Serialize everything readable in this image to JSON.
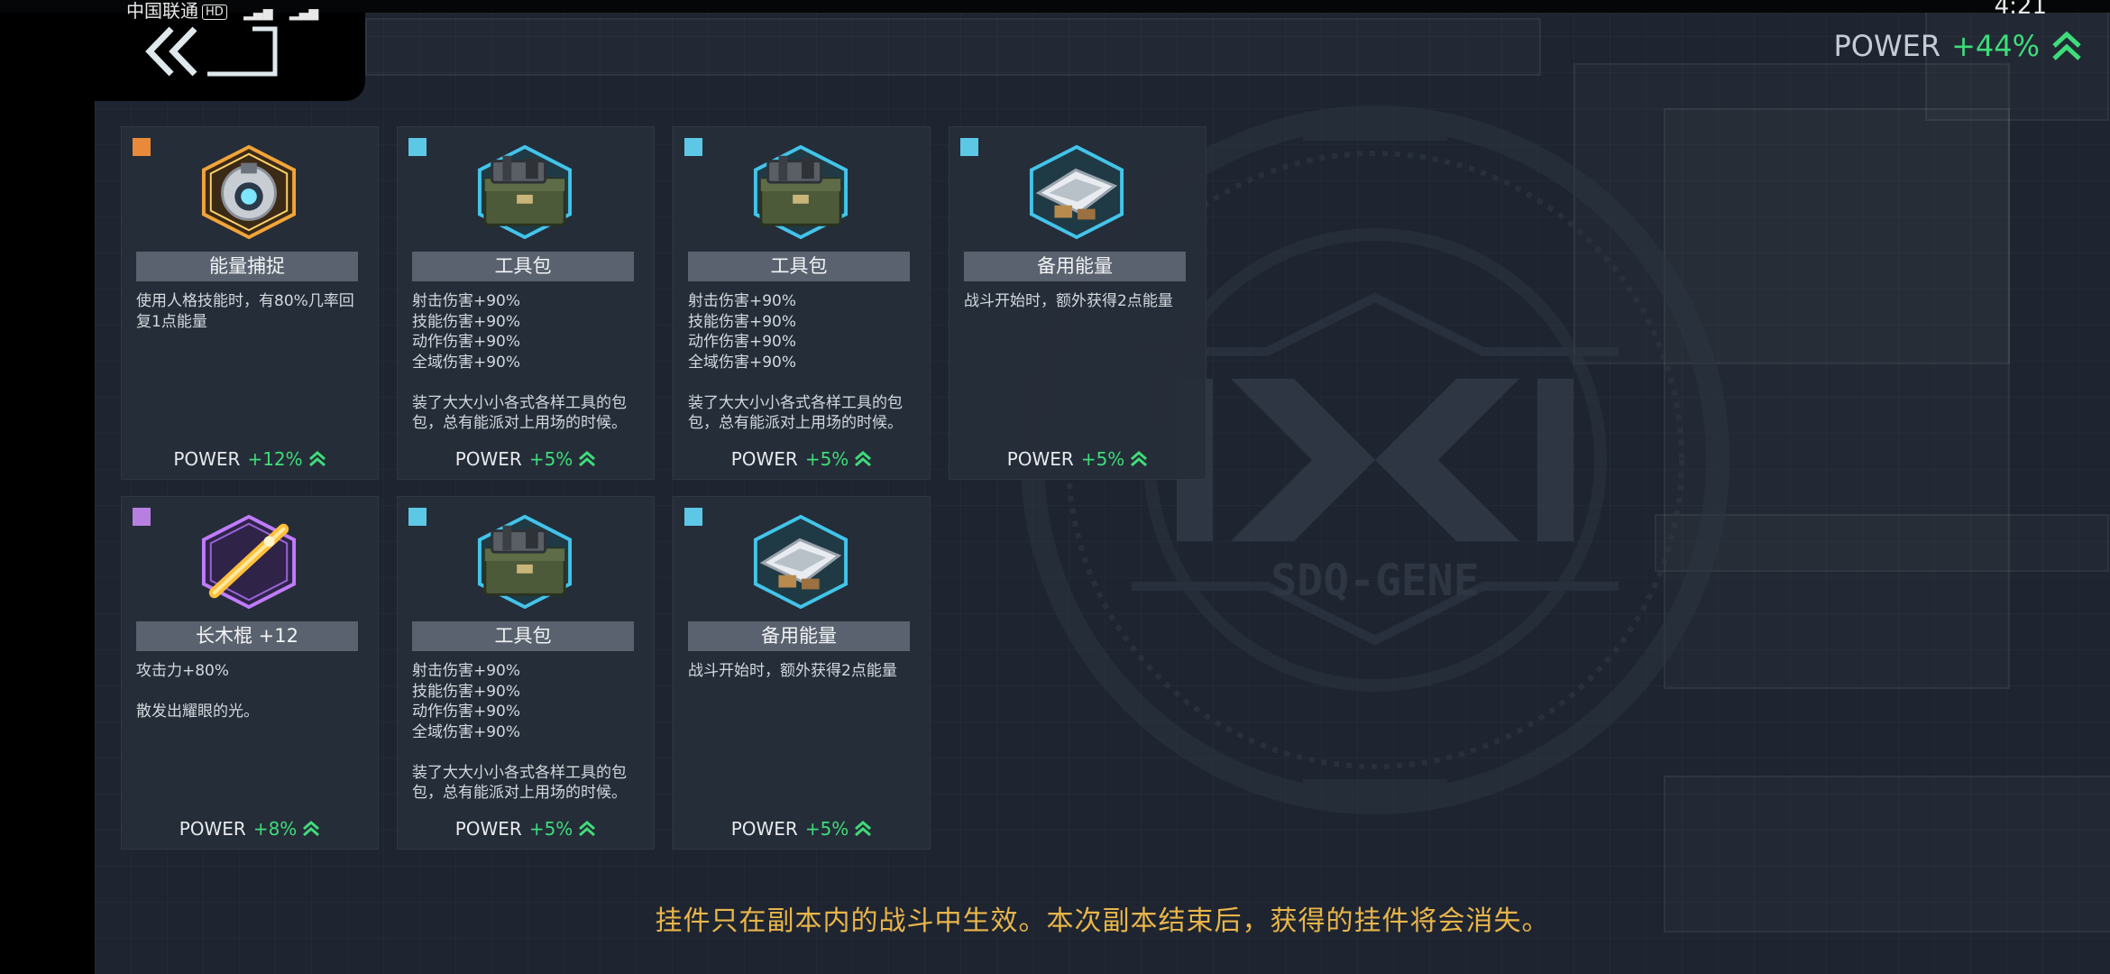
{
  "status_bar": {
    "carrier": "中国联通",
    "hd": "HD",
    "time": "4:21"
  },
  "header": {
    "power_label": "POWER",
    "power_value": "+44%"
  },
  "background": {
    "logo_text": "SDQ-GENE"
  },
  "cards": [
    {
      "rarity_color": "#e88a3a",
      "icon": "energy-capture-device-icon",
      "title": "能量捕捉",
      "desc": [
        "使用人格技能时，有80%几率回复1点能量"
      ],
      "power_label": "POWER",
      "power_value": "+12%"
    },
    {
      "rarity_color": "#5cc8e6",
      "icon": "toolbox-icon",
      "title": "工具包",
      "stats": [
        "射击伤害+90%",
        "技能伤害+90%",
        "动作伤害+90%",
        "全域伤害+90%"
      ],
      "flavor": "装了大大小小各式各样工具的包包，总有能派对上用场的时候。",
      "power_label": "POWER",
      "power_value": "+5%"
    },
    {
      "rarity_color": "#5cc8e6",
      "icon": "toolbox-icon",
      "title": "工具包",
      "stats": [
        "射击伤害+90%",
        "技能伤害+90%",
        "动作伤害+90%",
        "全域伤害+90%"
      ],
      "flavor": "装了大大小小各式各样工具的包包，总有能派对上用场的时候。",
      "power_label": "POWER",
      "power_value": "+5%"
    },
    {
      "rarity_color": "#5cc8e6",
      "icon": "backup-energy-icon",
      "title": "备用能量",
      "desc": [
        "战斗开始时，额外获得2点能量"
      ],
      "power_label": "POWER",
      "power_value": "+5%"
    },
    {
      "rarity_color": "#b77fe0",
      "icon": "long-staff-icon",
      "title": "长木棍 +12",
      "stats": [
        "攻击力+80%"
      ],
      "flavor": "散发出耀眼的光。",
      "power_label": "POWER",
      "power_value": "+8%"
    },
    {
      "rarity_color": "#5cc8e6",
      "icon": "toolbox-icon",
      "title": "工具包",
      "stats": [
        "射击伤害+90%",
        "技能伤害+90%",
        "动作伤害+90%",
        "全域伤害+90%"
      ],
      "flavor": "装了大大小小各式各样工具的包包，总有能派对上用场的时候。",
      "power_label": "POWER",
      "power_value": "+5%"
    },
    {
      "rarity_color": "#5cc8e6",
      "icon": "backup-energy-icon",
      "title": "备用能量",
      "desc": [
        "战斗开始时，额外获得2点能量"
      ],
      "power_label": "POWER",
      "power_value": "+5%"
    }
  ],
  "footer": {
    "notice": "挂件只在副本内的战斗中生效。本次副本结束后，获得的挂件将会消失。"
  },
  "colors": {
    "accent_green": "#3fdc7a",
    "notice_gold": "#e9b54a"
  }
}
